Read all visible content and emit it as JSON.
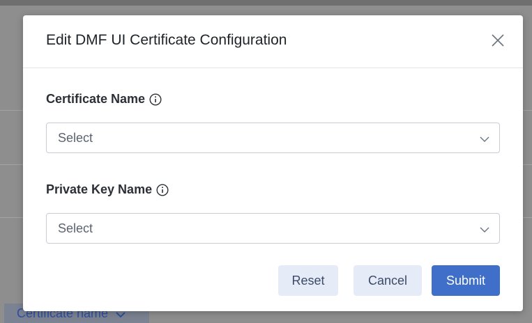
{
  "background": {
    "column_header_label": "Certificate name",
    "column_header_icon": "chevron-down-icon"
  },
  "modal": {
    "title": "Edit DMF UI Certificate Configuration",
    "close_icon": "close-icon",
    "fields": [
      {
        "label": "Certificate Name",
        "info_icon": "info-icon",
        "selected_value": "Select",
        "dropdown_icon": "chevron-down-icon"
      },
      {
        "label": "Private Key Name",
        "info_icon": "info-icon",
        "selected_value": "Select",
        "dropdown_icon": "chevron-down-icon"
      }
    ],
    "buttons": {
      "reset": "Reset",
      "cancel": "Cancel",
      "submit": "Submit"
    }
  },
  "colors": {
    "primary": "#3f6fc9",
    "secondary_button_bg": "#e6ecf7",
    "overlay": "#8e8e8e"
  }
}
